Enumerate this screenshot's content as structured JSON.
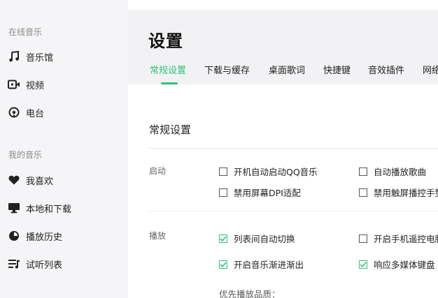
{
  "sidebar": {
    "online_title": "在线音乐",
    "online_items": [
      {
        "label": "音乐馆",
        "icon": "music-note-icon"
      },
      {
        "label": "视频",
        "icon": "video-icon"
      },
      {
        "label": "电台",
        "icon": "radio-icon"
      }
    ],
    "my_title": "我的音乐",
    "my_items": [
      {
        "label": "我喜欢",
        "icon": "heart-icon"
      },
      {
        "label": "本地和下载",
        "icon": "monitor-icon"
      },
      {
        "label": "播放历史",
        "icon": "clock-icon"
      },
      {
        "label": "试听列表",
        "icon": "playlist-icon"
      }
    ]
  },
  "header": {
    "title": "设置",
    "tabs": [
      "常规设置",
      "下载与缓存",
      "桌面歌词",
      "快捷键",
      "音效插件",
      "网络"
    ],
    "active_tab": 0
  },
  "content": {
    "section_title": "常规设置",
    "startup": {
      "label": "启动",
      "options": [
        {
          "text": "开机自动启动QQ音乐",
          "checked": false
        },
        {
          "text": "自动播放歌曲",
          "checked": false
        },
        {
          "text": "禁用屏幕DPI适配",
          "checked": false
        },
        {
          "text": "禁用触屏播控手势",
          "checked": false
        }
      ]
    },
    "playback": {
      "label": "播放",
      "options": [
        {
          "text": "列表间自动切换",
          "checked": true
        },
        {
          "text": "开启手机遥控电脑",
          "checked": false
        },
        {
          "text": "开启音乐渐进渐出",
          "checked": true
        },
        {
          "text": "响应多媒体键盘",
          "checked": true
        }
      ],
      "quality_label": "优先播放品质："
    }
  },
  "colors": {
    "accent": "#31c27c",
    "sidebar_bg": "#f5f5f7",
    "header_bg": "#f2f2f4"
  }
}
